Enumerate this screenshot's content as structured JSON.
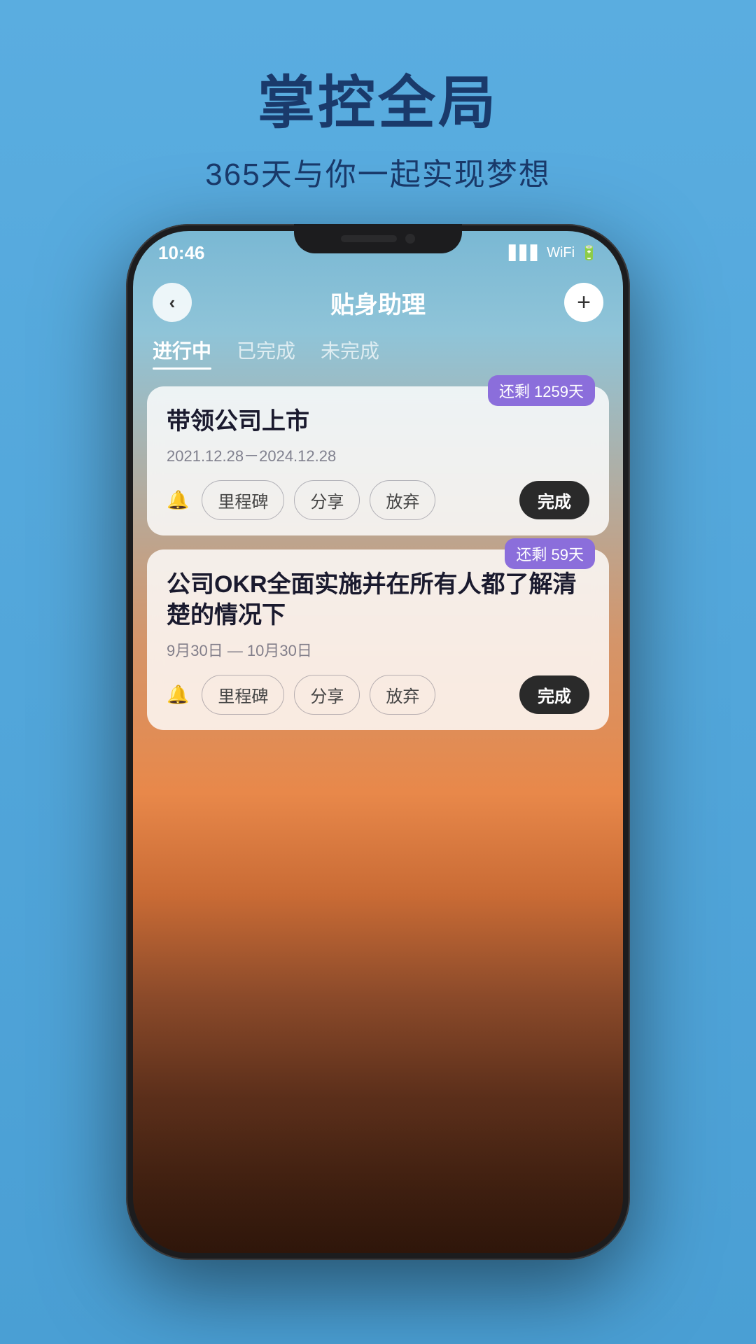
{
  "page": {
    "bg_color_top": "#5aade0",
    "bg_color_bottom": "#4a9fd4"
  },
  "header": {
    "title": "掌控全局",
    "subtitle": "365天与你一起实现梦想"
  },
  "phone": {
    "status_time": "10:46",
    "nav": {
      "title": "贴身助理",
      "back_icon": "‹",
      "add_icon": "+"
    },
    "tabs": [
      {
        "label": "进行中",
        "active": true
      },
      {
        "label": "已完成",
        "active": false
      },
      {
        "label": "未完成",
        "active": false
      }
    ],
    "cards": [
      {
        "badge": "还剩 1259天",
        "title": "带领公司上市",
        "date": "2021.12.28－2024.12.28",
        "actions": [
          "里程碑",
          "分享",
          "放弃"
        ],
        "complete_label": "完成"
      },
      {
        "badge": "还剩 59天",
        "title": "公司OKR全面实施并在所有人都了解清楚的情况下",
        "date": "9月30日 — 10月30日",
        "actions": [
          "里程碑",
          "分享",
          "放弃"
        ],
        "complete_label": "完成"
      }
    ]
  }
}
